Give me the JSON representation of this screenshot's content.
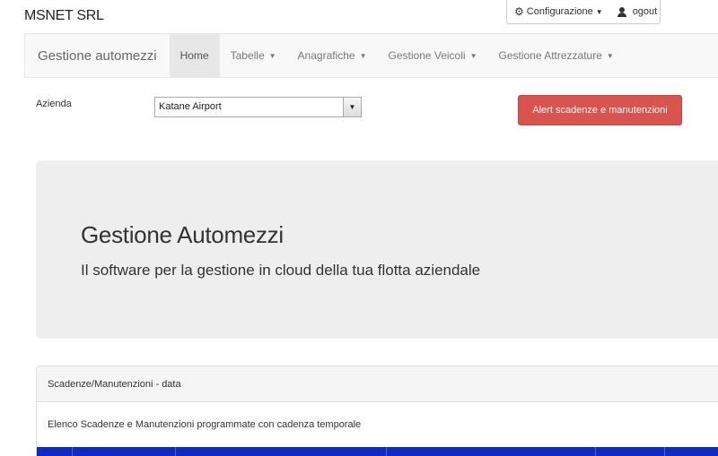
{
  "brand": "MSNET SRL",
  "topbar": {
    "config_label": "Configurazione",
    "logout_label": "ogout"
  },
  "navbar": {
    "brand": "Gestione automezzi",
    "items": [
      {
        "label": "Home",
        "active": true,
        "dropdown": false
      },
      {
        "label": "Tabelle",
        "active": false,
        "dropdown": true
      },
      {
        "label": "Anagrafiche",
        "active": false,
        "dropdown": true
      },
      {
        "label": "Gestione Veicoli",
        "active": false,
        "dropdown": true
      },
      {
        "label": "Gestione Attrezzature",
        "active": false,
        "dropdown": true
      }
    ]
  },
  "azienda": {
    "label": "Azienda",
    "selected": "Katane Airport"
  },
  "alert_button": "Alert scadenze e manutenzioni",
  "jumbotron": {
    "title": "Gestione Automezzi",
    "subtitle": "Il software per la gestione in cloud della tua flotta aziendale"
  },
  "panel": {
    "heading": "Scadenze/Manutenzioni - data",
    "body": "Elenco Scadenze e Manutenzioni programmate con cadenza temporale"
  },
  "colors": {
    "alert": "#d9534f",
    "table_header": "#0a2bc9",
    "jumbotron": "#eeeeee"
  }
}
